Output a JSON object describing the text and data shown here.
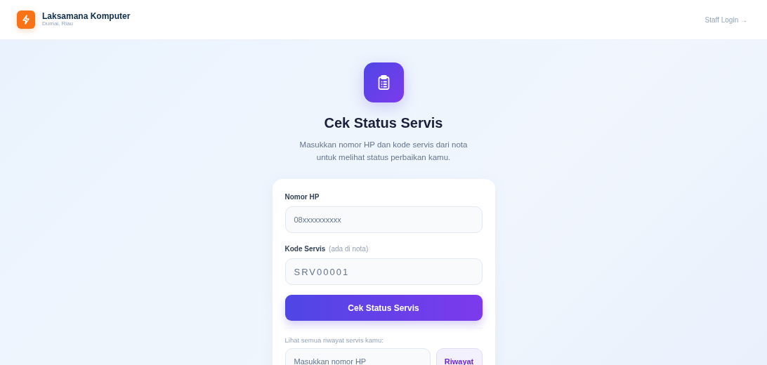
{
  "header": {
    "brand": "Laksamana Komputer",
    "location": "Dumai, Riau",
    "staff_login": "Staff Login →"
  },
  "hero": {
    "title": "Cek Status Servis",
    "subtitle": "Masukkan nomor HP dan kode servis dari nota untuk melihat status perbaikan kamu."
  },
  "form": {
    "fields": [
      {
        "label": "Nomor HP",
        "placeholder": "08xxxxxxxxxx",
        "kind": "phone"
      },
      {
        "label": "Kode Servis",
        "hint": "(ada di nota)",
        "placeholder": "SRV00001",
        "kind": "code"
      }
    ],
    "submit": "Cek Status Servis"
  },
  "history": {
    "label": "Lihat semua riwayat servis kamu:",
    "placeholder": "Masukkan nomor HP",
    "button": "Riwayat"
  }
}
